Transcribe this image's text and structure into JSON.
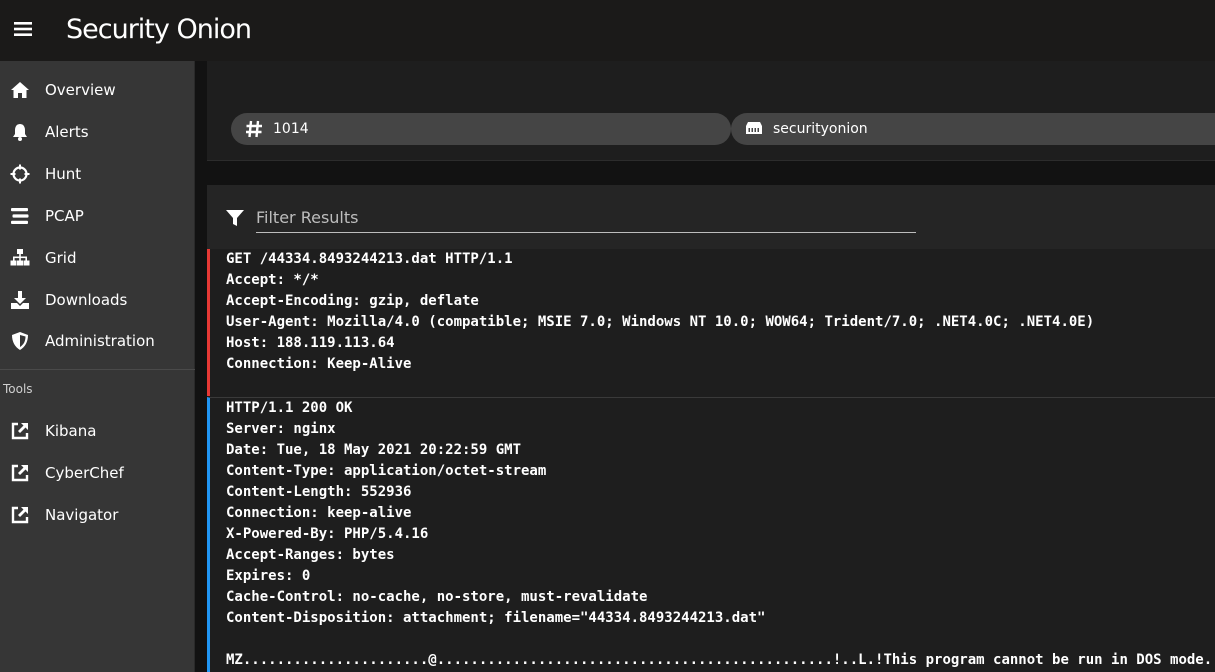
{
  "app": {
    "title": "Security Onion"
  },
  "sidebar": {
    "items": [
      {
        "label": "Overview",
        "icon": "home-icon"
      },
      {
        "label": "Alerts",
        "icon": "bell-icon"
      },
      {
        "label": "Hunt",
        "icon": "crosshairs-icon"
      },
      {
        "label": "PCAP",
        "icon": "stream-icon"
      },
      {
        "label": "Grid",
        "icon": "sitemap-icon"
      },
      {
        "label": "Downloads",
        "icon": "download-icon"
      },
      {
        "label": "Administration",
        "icon": "shield-icon"
      }
    ],
    "tools_label": "Tools",
    "tools": [
      {
        "label": "Kibana",
        "icon": "external-link-icon"
      },
      {
        "label": "CyberChef",
        "icon": "external-link-icon"
      },
      {
        "label": "Navigator",
        "icon": "external-link-icon"
      }
    ]
  },
  "header": {
    "chips": [
      {
        "icon": "hashtag-icon",
        "text": "1014"
      },
      {
        "icon": "server-icon",
        "text": "securityonion"
      }
    ]
  },
  "filter": {
    "placeholder": "Filter Results"
  },
  "colors": {
    "request_border": "#e53935",
    "response_border": "#2196f3"
  },
  "request": {
    "lines": [
      "GET /44334.8493244213.dat HTTP/1.1",
      "Accept: */*",
      "Accept-Encoding: gzip, deflate",
      "User-Agent: Mozilla/4.0 (compatible; MSIE 7.0; Windows NT 10.0; WOW64; Trident/7.0; .NET4.0C; .NET4.0E)",
      "Host: 188.119.113.64",
      "Connection: Keep-Alive"
    ]
  },
  "response": {
    "lines": [
      "HTTP/1.1 200 OK",
      "Server: nginx",
      "Date: Tue, 18 May 2021 20:22:59 GMT",
      "Content-Type: application/octet-stream",
      "Content-Length: 552936",
      "Connection: keep-alive",
      "X-Powered-By: PHP/5.4.16",
      "Accept-Ranges: bytes",
      "Expires: 0",
      "Cache-Control: no-cache, no-store, must-revalidate",
      "Content-Disposition: attachment; filename=\"44334.8493244213.dat\"",
      "",
      "MZ......................@...............................................!..L.!This program cannot be run in DOS mode."
    ]
  }
}
